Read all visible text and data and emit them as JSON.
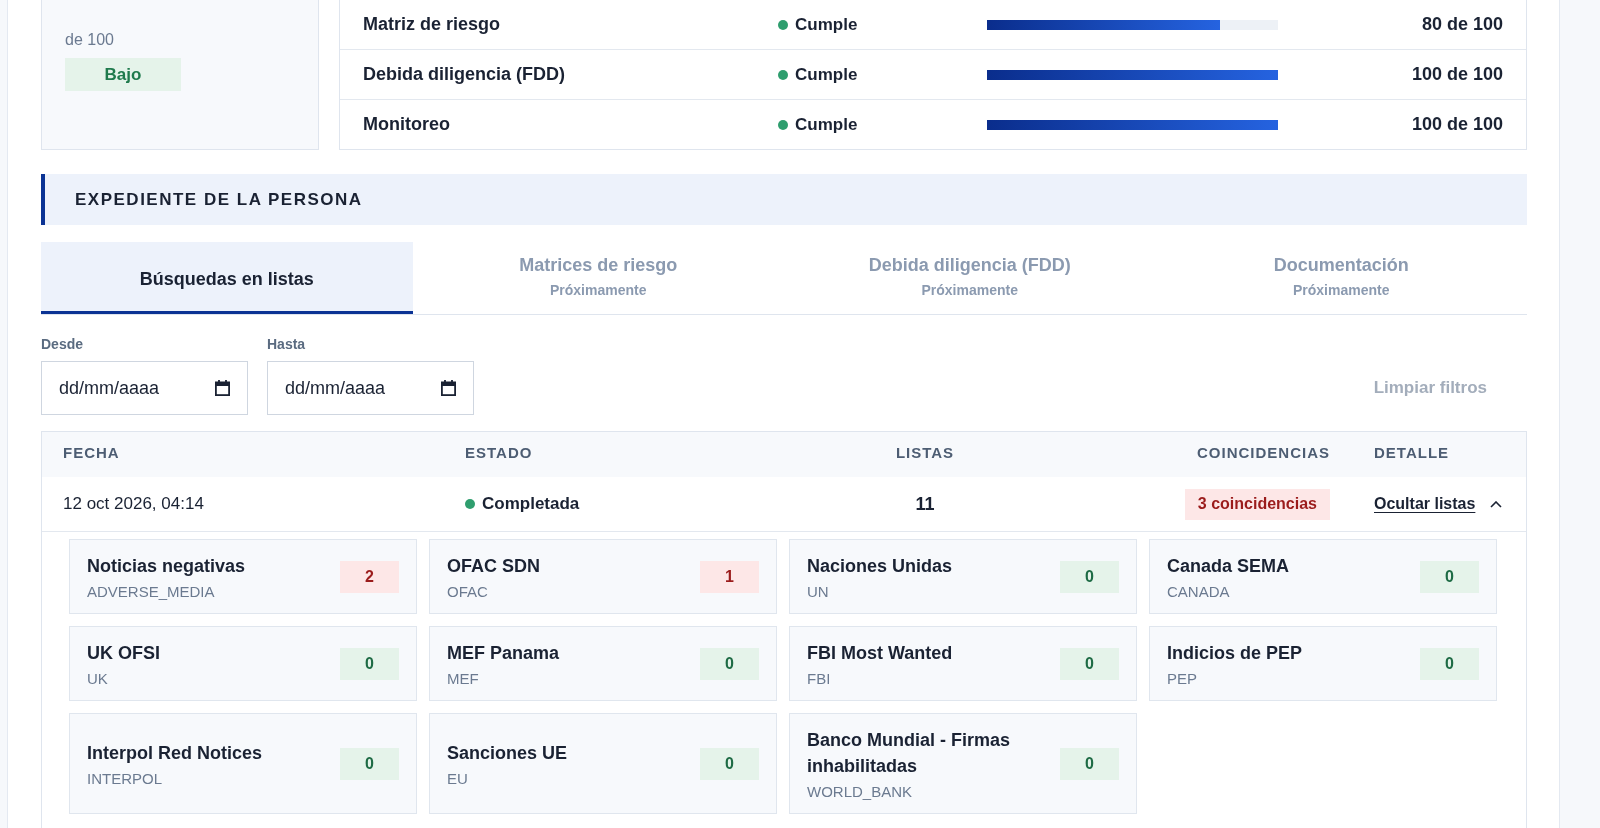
{
  "score": {
    "denominator": "de 100",
    "risk_badge": {
      "label": "Bajo",
      "kind": "low"
    }
  },
  "components": [
    {
      "name": "Matriz de riesgo",
      "status": "Cumple",
      "ok": true,
      "level": 0.8,
      "reading": "80 de 100"
    },
    {
      "name": "Debida diligencia (FDD)",
      "status": "Cumple",
      "ok": true,
      "level": 1,
      "reading": "100 de 100"
    },
    {
      "name": "Monitoreo",
      "status": "Cumple",
      "ok": true,
      "level": 1,
      "reading": "100 de 100"
    }
  ],
  "section": {
    "title": "EXPEDIENTE DE LA PERSONA"
  },
  "tabs": [
    {
      "label": "Búsquedas en listas",
      "selected": true,
      "disabled": false
    },
    {
      "label": "Matrices de riesgo",
      "note": "Próximamente",
      "selected": false,
      "disabled": true
    },
    {
      "label": "Debida diligencia (FDD)",
      "note": "Próximamente",
      "selected": false,
      "disabled": true
    },
    {
      "label": "Documentación",
      "note": "Próximamente",
      "selected": false,
      "disabled": true
    }
  ],
  "filters": {
    "fields": [
      {
        "label": "Desde",
        "placeholder": "dd/mm/aaaa"
      },
      {
        "label": "Hasta",
        "placeholder": "dd/mm/aaaa"
      }
    ],
    "clear_button": {
      "label": "Limpiar filtros",
      "disabled": true
    }
  },
  "table": {
    "columns": [
      "FECHA",
      "ESTADO",
      "LISTAS",
      "COINCIDENCIAS",
      "DETALLE"
    ],
    "rows": [
      {
        "date": "12 oct 2026, 04:14",
        "status": "Completada",
        "complete": true,
        "lists": "11",
        "matches": "3 coincidencias",
        "has_matches": true,
        "detail_link": "Ocultar listas",
        "expanded": true,
        "list_results": [
          {
            "name": "Noticias negativas",
            "code": "ADVERSE_MEDIA",
            "count": "2",
            "matched": true
          },
          {
            "name": "OFAC SDN",
            "code": "OFAC",
            "count": "1",
            "matched": true
          },
          {
            "name": "Naciones Unidas",
            "code": "UN",
            "count": "0",
            "matched": false
          },
          {
            "name": "Canada SEMA",
            "code": "CANADA",
            "count": "0",
            "matched": false
          },
          {
            "name": "UK OFSI",
            "code": "UK",
            "count": "0",
            "matched": false
          },
          {
            "name": "MEF Panama",
            "code": "MEF",
            "count": "0",
            "matched": false
          },
          {
            "name": "FBI Most Wanted",
            "code": "FBI",
            "count": "0",
            "matched": false
          },
          {
            "name": "Indicios de PEP",
            "code": "PEP",
            "count": "0",
            "matched": false
          },
          {
            "name": "Interpol Red Notices",
            "code": "INTERPOL",
            "count": "0",
            "matched": false
          },
          {
            "name": "Sanciones UE",
            "code": "EU",
            "count": "0",
            "matched": false
          },
          {
            "name": "Banco Mundial - Firmas inhabilitadas",
            "code": "WORLD_BANK",
            "count": "0",
            "matched": false
          }
        ]
      }
    ]
  }
}
